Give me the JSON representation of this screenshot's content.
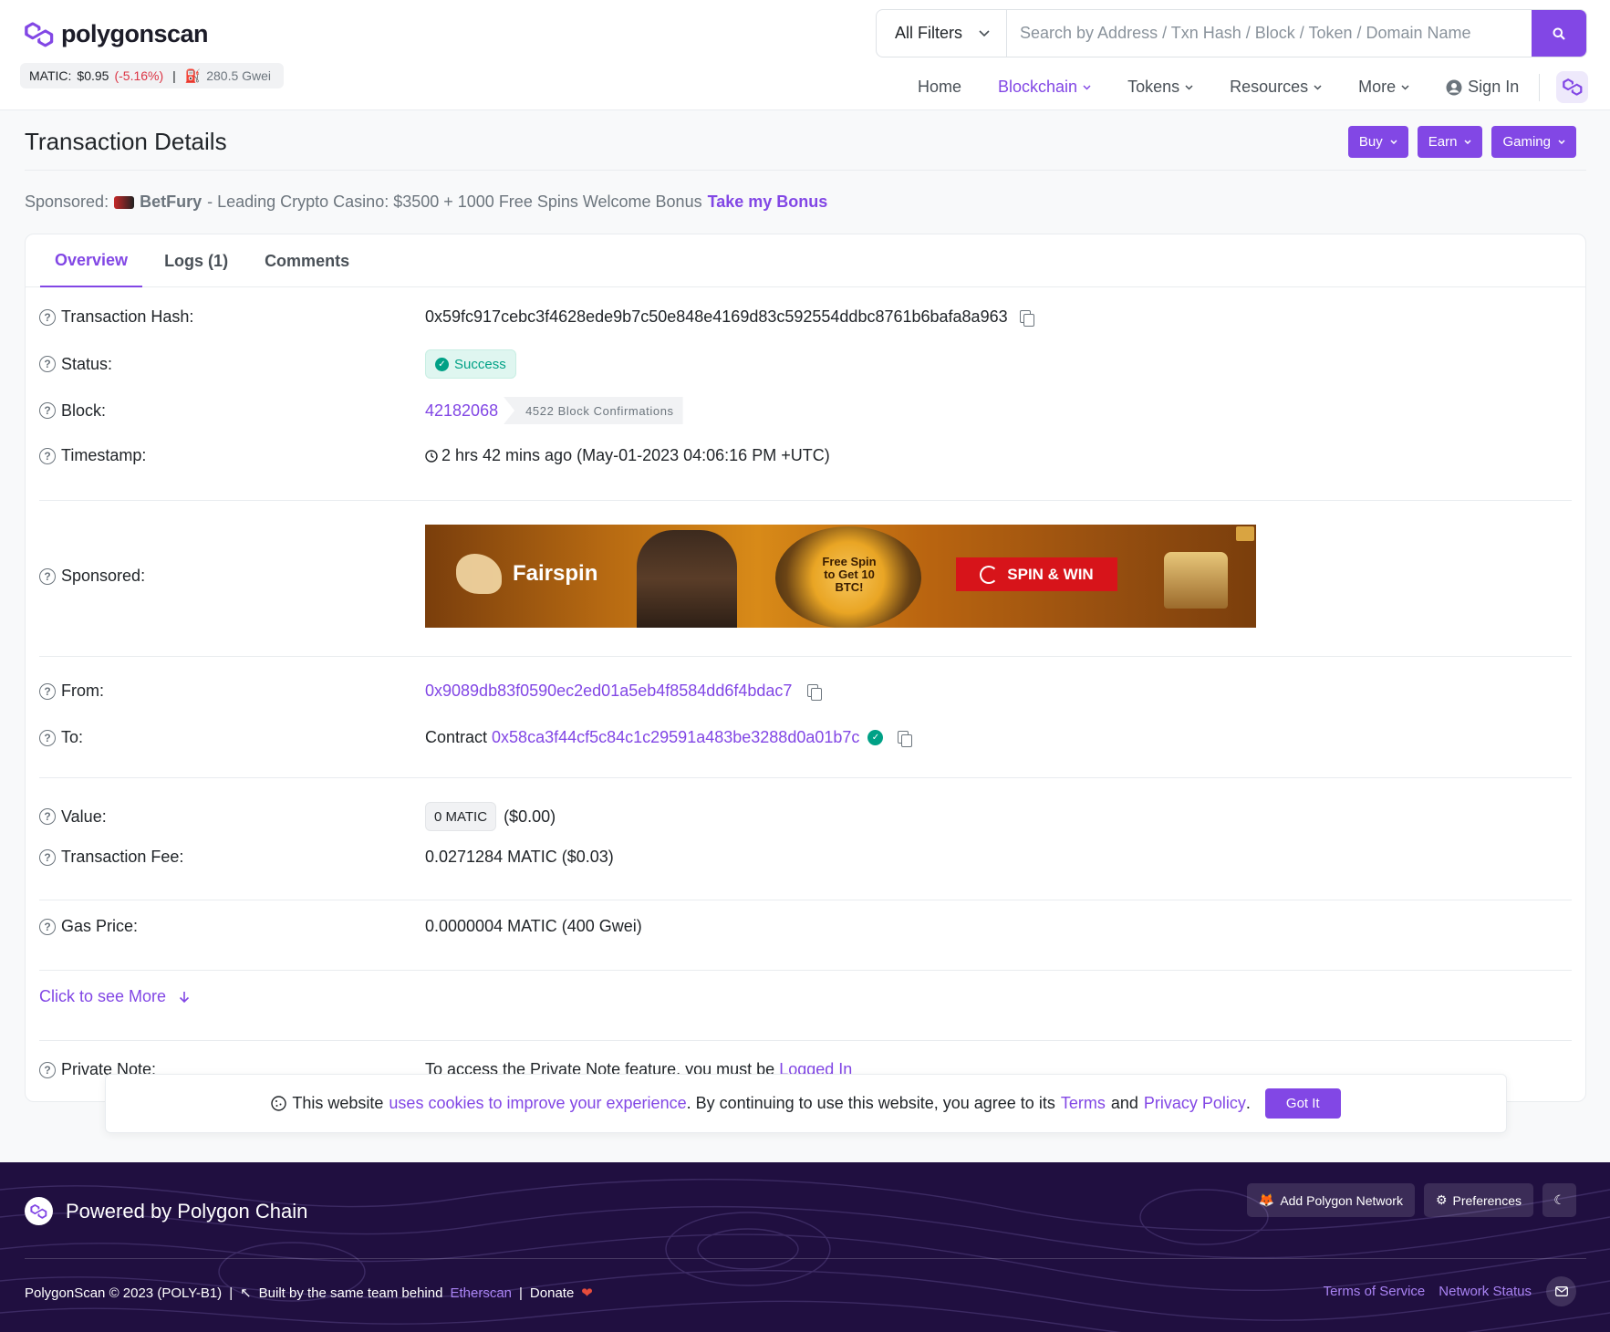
{
  "header": {
    "logo_text": "polygonscan",
    "price_label": "MATIC:",
    "price_value": "$0.95",
    "price_change": "(-5.16%)",
    "price_sep": "|",
    "gas": "280.5 Gwei",
    "filter_label": "All Filters",
    "search_placeholder": "Search by Address / Txn Hash / Block / Token / Domain Name",
    "nav": {
      "home": "Home",
      "blockchain": "Blockchain",
      "tokens": "Tokens",
      "resources": "Resources",
      "more": "More",
      "sign_in": "Sign In"
    }
  },
  "title_bar": {
    "title": "Transaction Details",
    "buy": "Buy",
    "earn": "Earn",
    "gaming": "Gaming"
  },
  "sponsored_line": {
    "prefix": "Sponsored:",
    "brand": "BetFury",
    "text": "- Leading Crypto Casino: $3500 + 1000 Free Spins Welcome Bonus",
    "cta": "Take my Bonus"
  },
  "tabs": {
    "overview": "Overview",
    "logs": "Logs (1)",
    "comments": "Comments"
  },
  "details": {
    "hash_label": "Transaction Hash:",
    "hash": "0x59fc917cebc3f4628ede9b7c50e848e4169d83c592554ddbc8761b6bafa8a963",
    "status_label": "Status:",
    "status": "Success",
    "block_label": "Block:",
    "block": "42182068",
    "confirmations": "4522 Block Confirmations",
    "timestamp_label": "Timestamp:",
    "timestamp": "2 hrs 42 mins ago (May-01-2023 04:06:16 PM +UTC)",
    "sponsored_label": "Sponsored:",
    "banner_brand": "Fairspin",
    "banner_wheel": "Free Spin to Get 10 BTC!",
    "banner_cta": "SPIN & WIN",
    "from_label": "From:",
    "from": "0x9089db83f0590ec2ed01a5eb4f8584dd6f4bdac7",
    "to_label": "To:",
    "to_prefix": "Contract",
    "to": "0x58ca3f44cf5c84c1c29591a483be3288d0a01b7c",
    "value_label": "Value:",
    "value": "0 MATIC",
    "value_usd": "($0.00)",
    "fee_label": "Transaction Fee:",
    "fee": "0.0271284 MATIC ($0.03)",
    "gas_label": "Gas Price:",
    "gas_price": "0.0000004 MATIC (400 Gwei)",
    "see_more": "Click to see More",
    "private_label": "Private Note:",
    "private_text": "To access the Private Note feature, you must be",
    "private_link": "Logged In"
  },
  "cookie": {
    "t1": "This website",
    "link1": "uses cookies to improve your experience",
    "t2": ". By continuing to use this website, you agree to its",
    "terms": "Terms",
    "t3": "and",
    "privacy": "Privacy Policy",
    "t4": ".",
    "button": "Got It"
  },
  "footer": {
    "powered": "Powered by Polygon Chain",
    "add_network": "Add Polygon Network",
    "preferences": "Preferences",
    "copyright": "PolygonScan © 2023 (POLY-B1)",
    "sep": "|",
    "built": "Built by the same team behind",
    "etherscan": "Etherscan",
    "donate": "Donate",
    "terms": "Terms of Service",
    "status": "Network Status"
  },
  "colors": {
    "accent": "#8247e5",
    "success": "#00a186",
    "footer_bg": "#200f40",
    "negative": "#dc3545"
  }
}
